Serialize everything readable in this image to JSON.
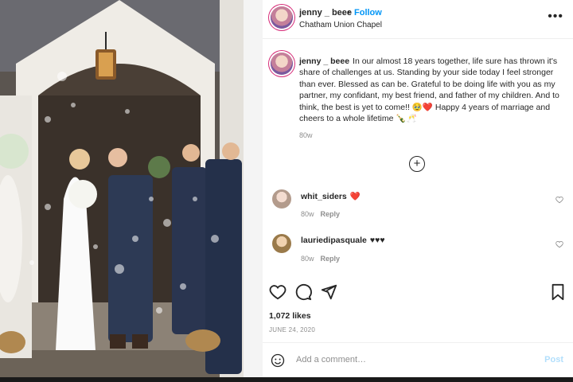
{
  "header": {
    "username": "jenny _ beee",
    "separator": "•",
    "follow_label": "Follow",
    "location": "Chatham Union Chapel",
    "more_label": "•••"
  },
  "caption": {
    "username": "jenny _ beee",
    "text": "In our almost 18 years together, life sure has thrown it's share of challenges at us. Standing by your side today I feel stronger than ever. Blessed as can be. Grateful to be doing life with you as my partner, my confidant, my best friend, and father of my children. And to think, the best is yet to come!! 🥹❤️ Happy 4 years of marriage and cheers to a whole lifetime 🍾🥂",
    "time": "80w"
  },
  "load_more_label": "+",
  "comments": [
    {
      "username": "whit_siders",
      "text": "❤️",
      "time": "80w",
      "reply": "Reply"
    },
    {
      "username": "lauriedipasquale",
      "text": "♥♥♥",
      "time": "80w",
      "reply": "Reply"
    }
  ],
  "likes": "1,072 likes",
  "date": "JUNE 24, 2020",
  "composer": {
    "placeholder": "Add a comment…",
    "post_label": "Post"
  },
  "colors": {
    "accent": "#0095f6",
    "heart": "#ed4956",
    "post_disabled": "#b2dffc"
  },
  "icons": [
    "more-icon",
    "plus-circle-icon",
    "heart-icon",
    "comment-icon",
    "share-icon",
    "bookmark-icon",
    "emoji-icon"
  ]
}
